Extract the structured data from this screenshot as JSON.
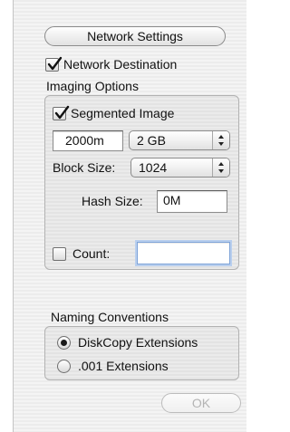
{
  "network_settings_button": "Network Settings",
  "network_destination": {
    "label": "Network Destination",
    "checked": true
  },
  "imaging_options": {
    "title": "Imaging Options",
    "segmented_image": {
      "label": "Segmented Image",
      "checked": true
    },
    "segment_count_value": "2000m",
    "segment_size_selected": "2 GB",
    "block_size": {
      "label": "Block Size:",
      "selected": "1024"
    },
    "hash_size": {
      "label": "Hash Size:",
      "value": "0M"
    },
    "count": {
      "label": "Count:",
      "checked": false,
      "value": ""
    }
  },
  "naming_conventions": {
    "title": "Naming Conventions",
    "options": [
      {
        "label": "DiskCopy Extensions",
        "selected": true
      },
      {
        "label": ".001 Extensions",
        "selected": false
      }
    ]
  },
  "ok_button": "OK",
  "icons": {
    "check": "checkmark-icon",
    "popup_arrows": "updown-arrows-icon",
    "radio_dot": "radio-dot-icon"
  }
}
